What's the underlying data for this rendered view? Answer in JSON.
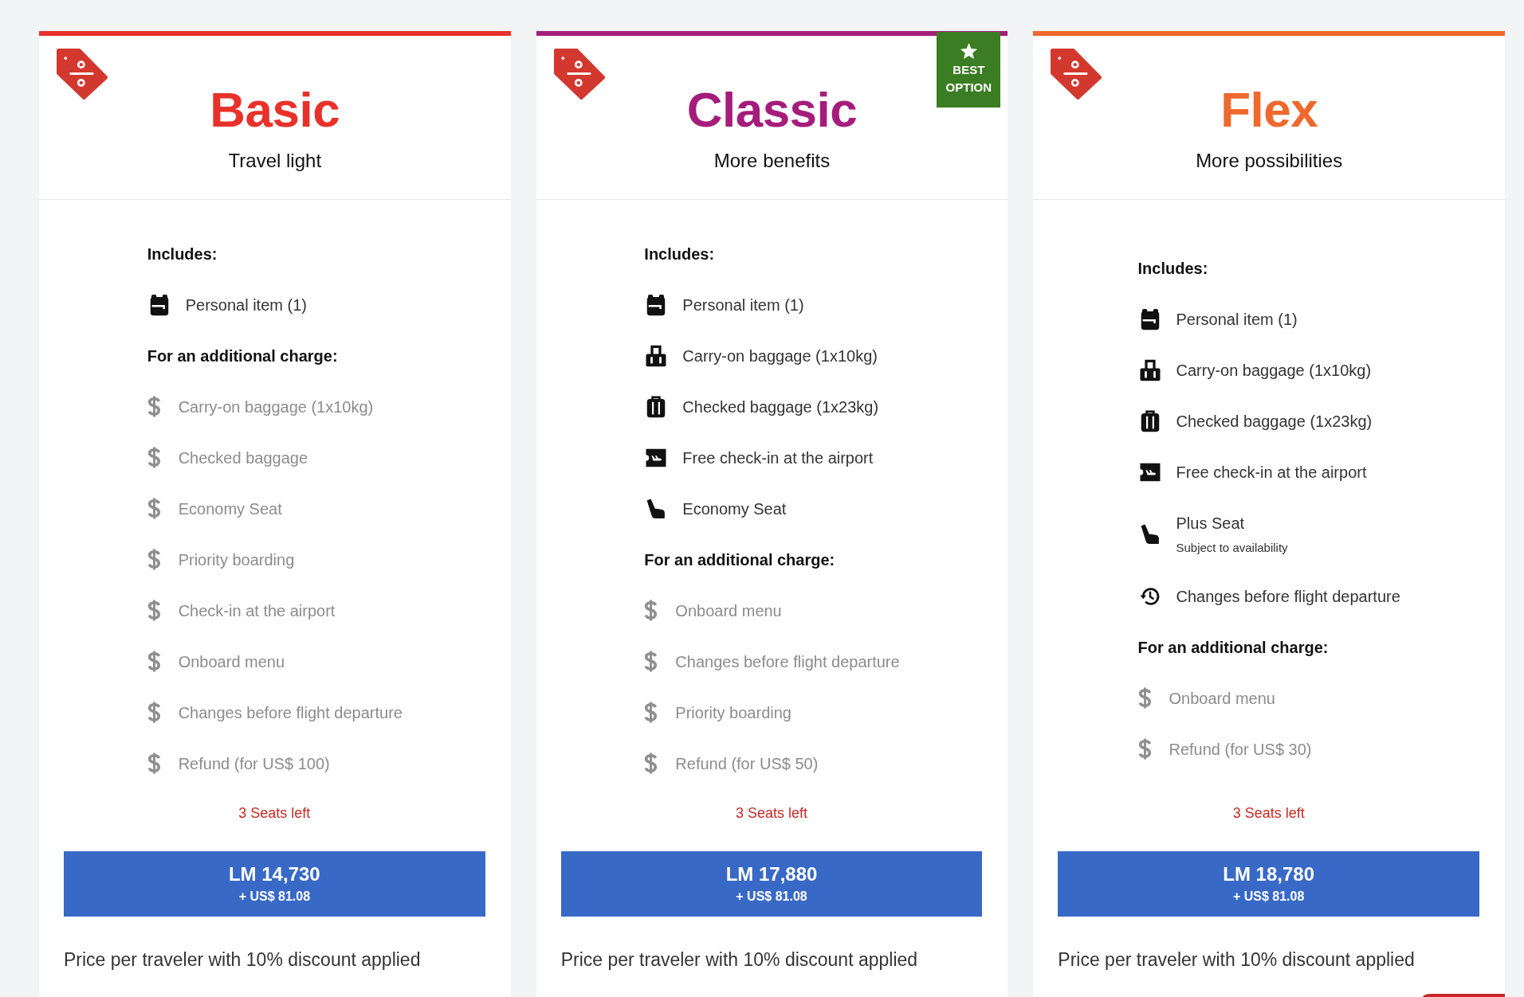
{
  "cards": [
    {
      "name": "Basic",
      "tagline": "Travel light",
      "color": "#e8312a",
      "includes_heading": "Includes:",
      "included": [
        {
          "kind": "backpack",
          "label": "Personal item (1)"
        }
      ],
      "extras_heading": "For an additional charge:",
      "extras": [
        "Carry-on baggage (1x10kg)",
        "Checked baggage",
        "Economy Seat",
        "Priority boarding",
        "Check-in at the airport",
        "Onboard menu",
        "Changes before flight departure",
        "Refund (for US$ 100)"
      ],
      "seats_left": "3 Seats left",
      "price": "LM 14,730",
      "taxes": "+ US$ 81.08",
      "footnote": "Price per traveler with 10% discount applied"
    },
    {
      "name": "Classic",
      "tagline": "More benefits",
      "color": "#a51d7b",
      "badge": "BEST OPTION",
      "includes_heading": "Includes:",
      "included": [
        {
          "kind": "backpack",
          "label": "Personal item (1)"
        },
        {
          "kind": "trolley",
          "label": "Carry-on baggage (1x10kg)"
        },
        {
          "kind": "suitcase",
          "label": "Checked baggage (1x23kg)"
        },
        {
          "kind": "checkin",
          "label": "Free check-in at the airport"
        },
        {
          "kind": "seat",
          "label": "Economy Seat"
        }
      ],
      "extras_heading": "For an additional charge:",
      "extras": [
        "Onboard menu",
        "Changes before flight departure",
        "Priority boarding",
        "Refund (for US$ 50)"
      ],
      "seats_left": "3 Seats left",
      "price": "LM 17,880",
      "taxes": "+ US$ 81.08",
      "footnote": "Price per traveler with 10% discount applied"
    },
    {
      "name": "Flex",
      "tagline": "More possibilities",
      "color": "#ef682c",
      "includes_heading": "Includes:",
      "included": [
        {
          "kind": "backpack",
          "label": "Personal item (1)"
        },
        {
          "kind": "trolley",
          "label": "Carry-on baggage (1x10kg)"
        },
        {
          "kind": "suitcase",
          "label": "Checked baggage (1x23kg)"
        },
        {
          "kind": "checkin",
          "label": "Free check-in at the airport"
        },
        {
          "kind": "seat",
          "label": "Plus Seat",
          "note": "Subject to availability"
        },
        {
          "kind": "history",
          "label": "Changes before flight departure"
        }
      ],
      "extras_heading": "For an additional charge:",
      "extras": [
        "Onboard menu",
        "Refund (for US$ 30)"
      ],
      "seats_left": "3 Seats left",
      "price": "LM 18,780",
      "taxes": "+ US$ 81.08",
      "footnote": "Price per traveler with 10% discount applied"
    }
  ]
}
